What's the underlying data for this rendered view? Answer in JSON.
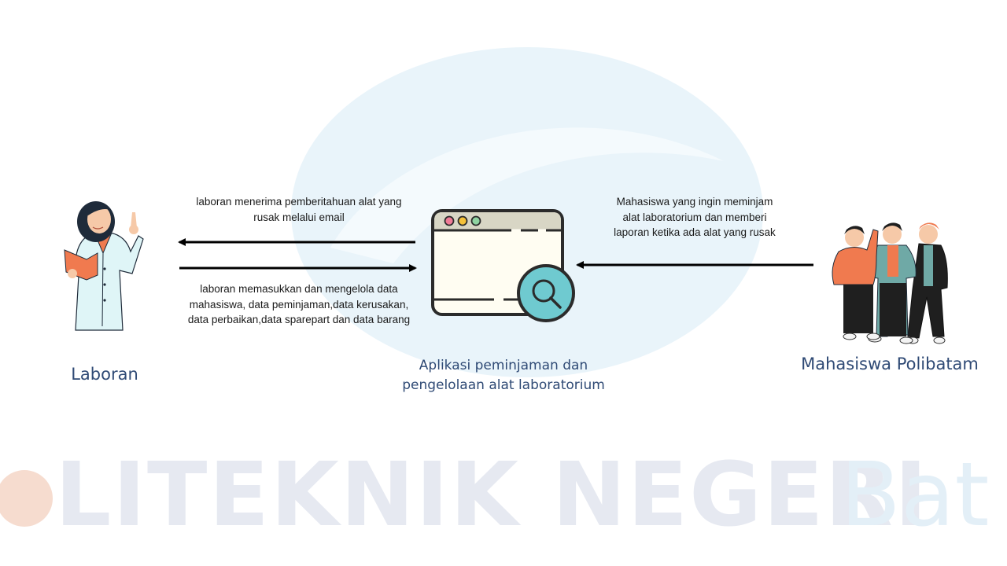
{
  "watermark": {
    "brand_text": "LITEKNIK NEGERI",
    "brand_suffix": "Bat",
    "colors": {
      "orange": "#f6dccf",
      "navy": "#e6e9f1",
      "blue": "#e3eff7",
      "ellipse": "#e9f4fa"
    }
  },
  "actors": {
    "laboran": {
      "label": "Laboran",
      "icon": "female-lab-worker-illustration"
    },
    "system": {
      "label_lines": [
        "Aplikasi peminjaman dan",
        "pengelolaan alat laboratorium"
      ],
      "icon": "browser-window-magnifier-icon"
    },
    "mahasiswa": {
      "label": "Mahasiswa Polibatam",
      "icon": "three-students-illustration"
    }
  },
  "flows": {
    "system_to_laboran": [
      "laboran menerima pemberitahuan alat yang",
      "rusak melalui email"
    ],
    "laboran_to_system": [
      "laboran memasukkan dan mengelola data",
      "mahasiswa, data peminjaman,data kerusakan,",
      "data perbaikan,data sparepart dan data barang"
    ],
    "mahasiswa_to_system": [
      "Mahasiswa yang ingin meminjam",
      "alat laboratorium dan memberi",
      "laporan ketika ada alat yang rusak"
    ]
  },
  "colors": {
    "label_text": "#2f4a75",
    "arrow": "#000000",
    "app_window": "#fffdf2",
    "app_titlebar": "#d8d6c5",
    "dot_red": "#f07c97",
    "dot_yellow": "#f5c23a",
    "dot_green": "#8fd3a1",
    "magnifier": "#6fcad0",
    "orange_clothes": "#f07a4f",
    "lab_coat": "#dff5f7",
    "teal_jacket": "#6fa9a6"
  }
}
